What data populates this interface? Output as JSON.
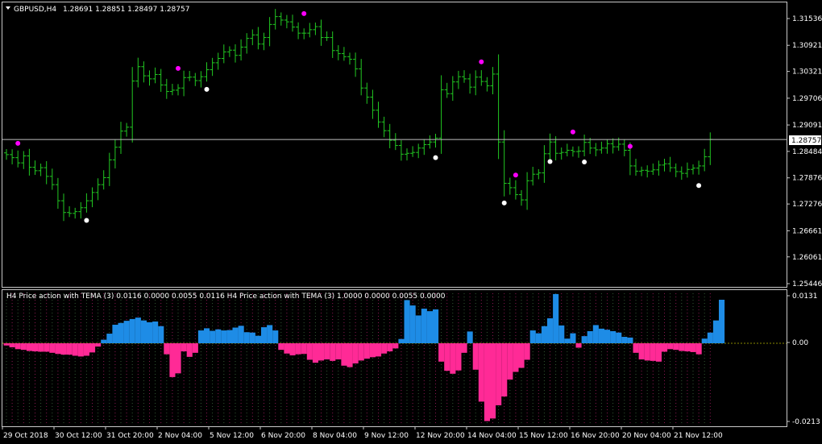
{
  "header": {
    "dropdown_icon": "triangle-down-icon",
    "symbol": "GBPUSD,H4",
    "ohlc": "1.28691 1.28851 1.28497 1.28757"
  },
  "indicator": {
    "label": "H4 Price action with TEMA (3) 0.0116 0.0000 0.0055 0.0116  H4 Price action with TEMA (3) 1.0000 0.0000 0.0055 0.0000"
  },
  "colors": {
    "background": "#000000",
    "bars": "#22c822",
    "up_dot": "#ff00ff",
    "down_dot": "#ffffff",
    "hist_pos": "#1e8ce6",
    "hist_neg": "#ff2a96",
    "grid_dot": "#5fa05f",
    "zero_line": "#8a8a00",
    "price_line": "#c0c0c0"
  },
  "price_axis": [
    "1.31536",
    "1.30921",
    "1.30321",
    "1.29706",
    "1.29091",
    "1.28484",
    "1.27876",
    "1.27276",
    "1.26661",
    "1.26061",
    "1.25446"
  ],
  "current_price": "1.28757",
  "indicator_axis": [
    "0.0131",
    "0.00",
    "-0.0213"
  ],
  "time_axis": [
    "29 Oct 2018",
    "30 Oct 12:00",
    "31 Oct 20:00",
    "2 Nov 04:00",
    "5 Nov 12:00",
    "6 Nov 20:00",
    "8 Nov 04:00",
    "9 Nov 12:00",
    "12 Nov 20:00",
    "14 Nov 04:00",
    "15 Nov 12:00",
    "16 Nov 20:00",
    "20 Nov 04:00",
    "21 Nov 12:00"
  ],
  "chart_data": [
    {
      "type": "ohlc",
      "symbol": "GBPUSD,H4",
      "ylim": [
        1.25446,
        1.31536
      ],
      "last_close": 1.28757,
      "closes": [
        1.2841,
        1.2834,
        1.2822,
        1.2838,
        1.2812,
        1.2804,
        1.2811,
        1.2791,
        1.2772,
        1.2735,
        1.2708,
        1.2706,
        1.271,
        1.2719,
        1.2735,
        1.2754,
        1.2772,
        1.2788,
        1.2829,
        1.2858,
        1.2895,
        1.2904,
        1.301,
        1.3043,
        1.3022,
        1.3015,
        1.3025,
        1.3001,
        1.2986,
        1.2989,
        1.2994,
        1.3018,
        1.3019,
        1.3011,
        1.302,
        1.3036,
        1.3052,
        1.3062,
        1.3077,
        1.3081,
        1.3069,
        1.3088,
        1.3108,
        1.3116,
        1.3095,
        1.311,
        1.314,
        1.3158,
        1.315,
        1.3146,
        1.3134,
        1.312,
        1.312,
        1.3128,
        1.3135,
        1.311,
        1.311,
        1.308,
        1.3073,
        1.3066,
        1.306,
        1.3038,
        1.2994,
        1.2973,
        1.2943,
        1.2916,
        1.2896,
        1.2874,
        1.2862,
        1.2842,
        1.2844,
        1.2846,
        1.2856,
        1.2864,
        1.287,
        1.2879,
        1.299,
        1.2981,
        1.3008,
        1.302,
        1.3015,
        1.2996,
        1.3019,
        1.3009,
        1.2999,
        1.3026,
        1.287,
        1.2775,
        1.2765,
        1.2749,
        1.2737,
        1.2781,
        1.2796,
        1.2799,
        1.2843,
        1.287,
        1.2844,
        1.2846,
        1.2851,
        1.2848,
        1.2849,
        1.2869,
        1.2856,
        1.2852,
        1.2856,
        1.2866,
        1.2859,
        1.2865,
        1.2851,
        1.2815,
        1.2803,
        1.2805,
        1.2803,
        1.2806,
        1.2817,
        1.282,
        1.2811,
        1.2802,
        1.2798,
        1.2807,
        1.281,
        1.2815,
        1.2836,
        1.2876
      ]
    },
    {
      "type": "bar",
      "name": "Price action with TEMA (3)",
      "ylim": [
        -0.0213,
        0.0131
      ],
      "values": [
        -0.0006,
        -0.0011,
        -0.0016,
        -0.0018,
        -0.0021,
        -0.0022,
        -0.0023,
        -0.0023,
        -0.0026,
        -0.0029,
        -0.0031,
        -0.0031,
        -0.0034,
        -0.0036,
        -0.0034,
        -0.0025,
        -0.0009,
        0.001,
        0.0027,
        0.0052,
        0.0057,
        0.0063,
        0.0068,
        0.0072,
        0.0064,
        0.0059,
        0.0061,
        0.0048,
        -0.003,
        -0.0092,
        -0.0082,
        -0.0022,
        -0.0037,
        -0.0026,
        0.0036,
        0.0042,
        0.0035,
        0.0039,
        0.0036,
        0.0037,
        0.0044,
        0.0049,
        0.0031,
        0.003,
        0.0021,
        0.0045,
        0.0051,
        0.0036,
        -0.0018,
        -0.0028,
        -0.0033,
        -0.003,
        -0.0029,
        -0.0045,
        -0.0053,
        -0.0047,
        -0.0044,
        -0.0048,
        -0.0044,
        -0.0061,
        -0.0065,
        -0.0055,
        -0.0047,
        -0.0042,
        -0.0038,
        -0.0036,
        -0.0028,
        -0.0022,
        -0.0014,
        0.0012,
        0.0121,
        0.0106,
        0.0078,
        0.0097,
        0.009,
        0.0095,
        -0.005,
        -0.0075,
        -0.0083,
        -0.0074,
        -0.0026,
        0.0033,
        -0.0072,
        -0.0159,
        -0.0212,
        -0.0205,
        -0.0169,
        -0.0145,
        -0.0099,
        -0.0078,
        -0.0067,
        -0.0045,
        0.0036,
        0.0028,
        0.0048,
        0.007,
        0.0138,
        0.005,
        0.0013,
        0.0028,
        -0.0012,
        0.002,
        0.0034,
        0.0051,
        0.0041,
        0.0038,
        0.0034,
        0.003,
        0.0018,
        0.0016,
        -0.0026,
        -0.0044,
        -0.0047,
        -0.0048,
        -0.005,
        -0.0023,
        -0.0016,
        -0.0018,
        -0.0021,
        -0.0022,
        -0.0024,
        -0.003,
        0.0013,
        0.003,
        0.0064,
        0.0122
      ]
    }
  ]
}
